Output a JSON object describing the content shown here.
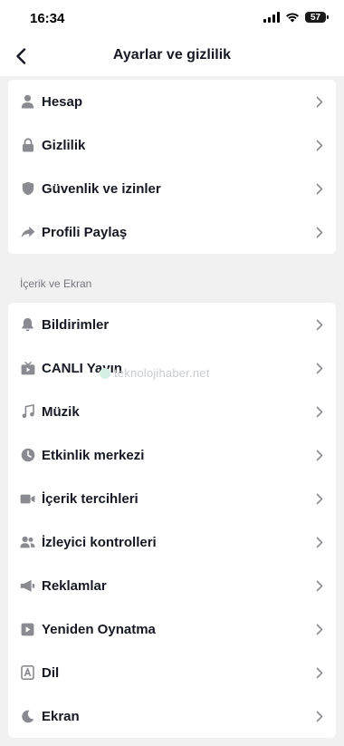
{
  "status_bar": {
    "time": "16:34",
    "battery": "57"
  },
  "header": {
    "title": "Ayarlar ve gizlilik"
  },
  "account_section": {
    "items": [
      {
        "label": "Hesap",
        "icon": "person-icon"
      },
      {
        "label": "Gizlilik",
        "icon": "lock-icon"
      },
      {
        "label": "Güvenlik ve izinler",
        "icon": "shield-icon"
      },
      {
        "label": "Profili Paylaş",
        "icon": "share-arrow-icon"
      }
    ]
  },
  "content_section": {
    "title": "İçerik ve Ekran",
    "items": [
      {
        "label": "Bildirimler",
        "icon": "bell-icon"
      },
      {
        "label": "CANLI Yayın",
        "icon": "tv-icon"
      },
      {
        "label": "Müzik",
        "icon": "music-note-icon"
      },
      {
        "label": "Etkinlik merkezi",
        "icon": "clock-icon"
      },
      {
        "label": "İçerik tercihleri",
        "icon": "video-camera-icon"
      },
      {
        "label": "İzleyici kontrolleri",
        "icon": "people-icon"
      },
      {
        "label": "Reklamlar",
        "icon": "megaphone-icon"
      },
      {
        "label": "Yeniden Oynatma",
        "icon": "play-icon"
      },
      {
        "label": "Dil",
        "icon": "language-a-icon"
      },
      {
        "label": "Ekran",
        "icon": "moon-icon"
      }
    ]
  },
  "watermark": {
    "text": "teknolojihaber.net"
  },
  "colors": {
    "background": "#f1f1f2",
    "card": "#ffffff",
    "text": "#161823",
    "icon": "#8a8b91",
    "chevron": "#8a8b91"
  }
}
